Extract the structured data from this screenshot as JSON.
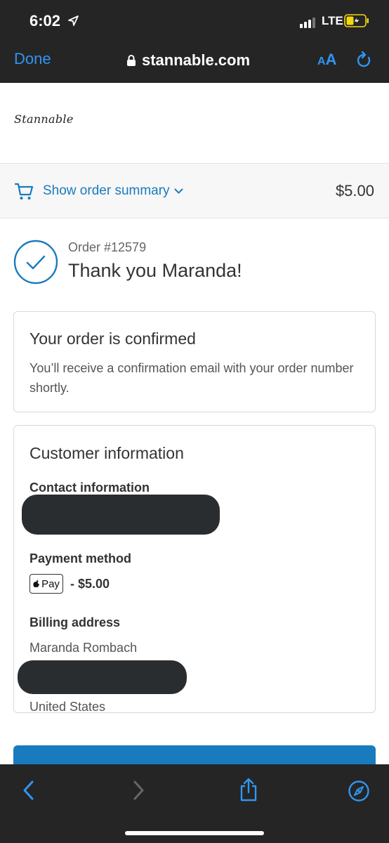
{
  "status_bar": {
    "time": "6:02",
    "network": "LTE"
  },
  "browser": {
    "done_label": "Done",
    "url": "stannable.com",
    "text_size_small": "A",
    "text_size_big": "A"
  },
  "shop": {
    "logo_text": "Stannable"
  },
  "order_summary": {
    "toggle_label": "Show order summary",
    "total": "$5.00"
  },
  "order": {
    "number": "Order #12579",
    "thank_you": "Thank you Maranda!"
  },
  "confirmation": {
    "heading": "Your order is confirmed",
    "message": "You’ll receive a confirmation email with your order number shortly."
  },
  "customer": {
    "heading": "Customer information",
    "contact_label": "Contact information",
    "payment_label": "Payment method",
    "payment_badge": "Pay",
    "payment_amount": "- $5.00",
    "billing_label": "Billing address",
    "billing_name": "Maranda Rombach",
    "billing_country": "United States"
  },
  "colors": {
    "accent": "#197bbd",
    "ios_blue": "#3096f2",
    "chrome_bg": "#252525",
    "battery_fill": "#f5d80f"
  },
  "icons": [
    "location-arrow-icon",
    "signal-icon",
    "battery-charging-icon",
    "lock-icon",
    "reload-icon",
    "cart-icon",
    "chevron-down-icon",
    "checkmark-circle-icon",
    "apple-logo-icon",
    "back-arrow-icon",
    "forward-arrow-icon",
    "share-icon",
    "compass-icon"
  ]
}
